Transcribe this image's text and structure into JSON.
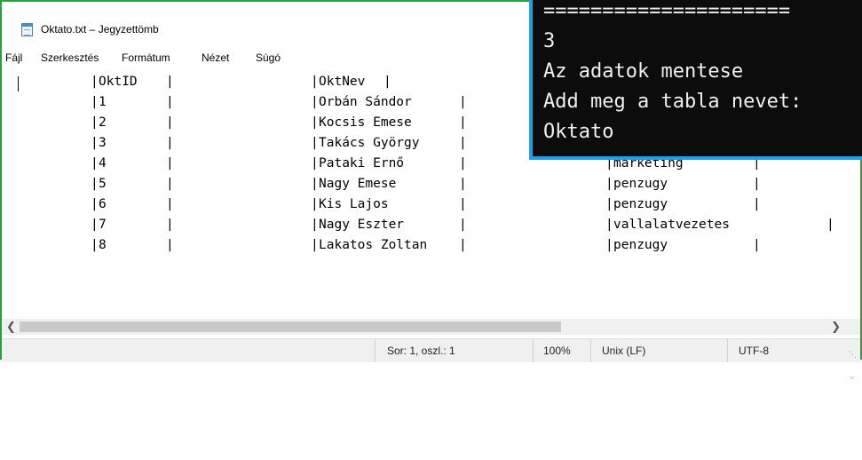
{
  "notepad": {
    "title": "Oktato.txt – Jegyzettömb",
    "menu": [
      "Fájl",
      "Szerkesztés",
      "Formátum",
      "Nézet",
      "Súgó"
    ],
    "header": {
      "id": "OktID",
      "name": "OktNev"
    },
    "rows": [
      {
        "id": "1",
        "name": "Orbán Sándor",
        "dept": ""
      },
      {
        "id": "2",
        "name": "Kocsis Emese",
        "dept": ""
      },
      {
        "id": "3",
        "name": "Takács György",
        "dept": ""
      },
      {
        "id": "4",
        "name": "Pataki Ernő",
        "dept": "marketing"
      },
      {
        "id": "5",
        "name": "Nagy Emese",
        "dept": "penzugy"
      },
      {
        "id": "6",
        "name": "Kis Lajos",
        "dept": "penzugy"
      },
      {
        "id": "7",
        "name": "Nagy Eszter",
        "dept": "vallalatvezetes"
      },
      {
        "id": "8",
        "name": "Lakatos Zoltan",
        "dept": "penzugy"
      }
    ],
    "status": {
      "position": "Sor: 1, oszl.: 1",
      "zoom": "100%",
      "line_ending": "Unix (LF)",
      "encoding": "UTF-8"
    },
    "scroll_left_icon": "chevron-left-icon",
    "scroll_right_icon": "chevron-right-icon"
  },
  "console": {
    "lines": [
      "=====================",
      "3",
      "Az adatok mentese",
      "Add meg a tabla nevet:",
      "Oktato"
    ]
  },
  "colors": {
    "window_border": "#1fa63b",
    "console_border": "#1ea0e8",
    "console_bg": "#0c0c0c"
  }
}
